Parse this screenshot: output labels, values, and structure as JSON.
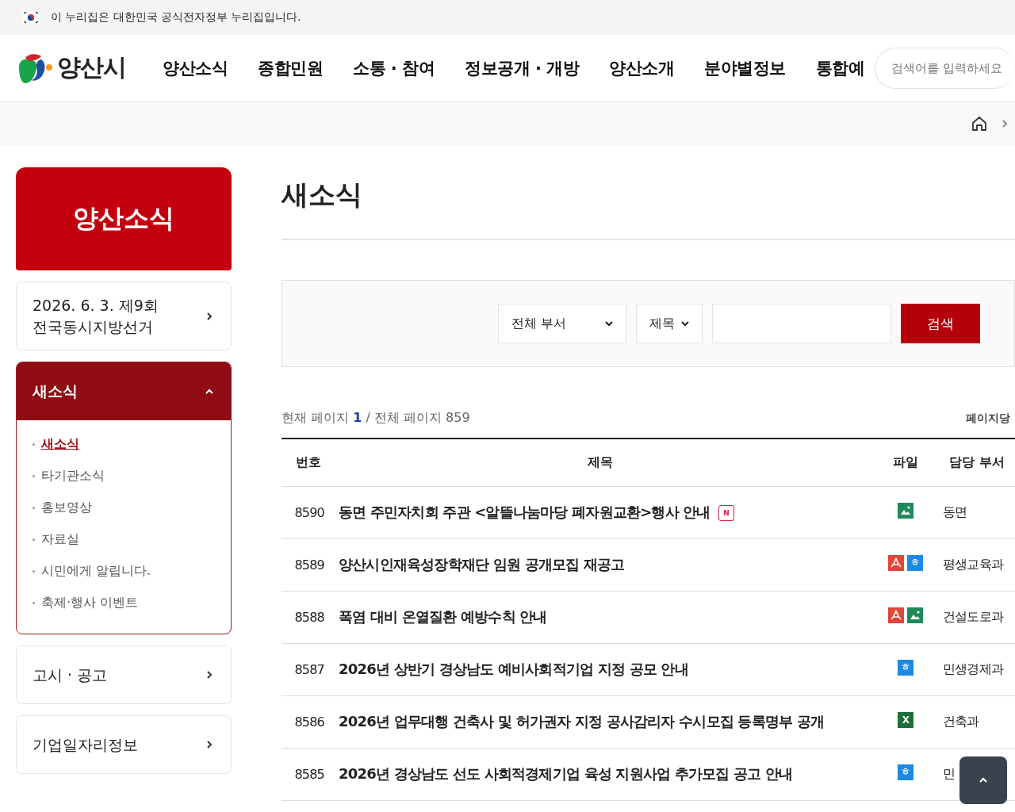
{
  "gov_banner": {
    "text": "이 누리집은 대한민국 공식전자정부 누리집입니다."
  },
  "header": {
    "logo_text": "양산시",
    "nav": [
      "양산소식",
      "종합민원",
      "소통 · 참여",
      "정보공개 · 개방",
      "양산소개",
      "분야별정보",
      "통합예"
    ],
    "search": {
      "placeholder": "검색어를 입력하세요"
    }
  },
  "sidebar": {
    "title": "양산소식",
    "menus": [
      {
        "label": "2026. 6. 3. 제9회\n전국동시지방선거",
        "expanded": false
      },
      {
        "label": "새소식",
        "expanded": true,
        "children": [
          {
            "label": "새소식",
            "selected": true
          },
          {
            "label": "타기관소식",
            "selected": false
          },
          {
            "label": "홍보영상",
            "selected": false
          },
          {
            "label": "자료실",
            "selected": false
          },
          {
            "label": "시민에게 알립니다.",
            "selected": false
          },
          {
            "label": "축제·행사 이벤트",
            "selected": false
          }
        ]
      },
      {
        "label": "고시 · 공고",
        "expanded": false
      },
      {
        "label": "기업일자리정보",
        "expanded": false
      }
    ]
  },
  "page": {
    "title": "새소식",
    "search": {
      "department": "전체 부서",
      "field": "제목",
      "button": "검색"
    },
    "paging": {
      "prefix": "현재 페이지",
      "current": "1",
      "suffix": "/ 전체 페이지 859",
      "per_page": "페이지당"
    },
    "table": {
      "columns": [
        "번호",
        "제목",
        "파일",
        "담당 부서"
      ],
      "rows": [
        {
          "number": "8590",
          "title": "동면 주민자치회 주관 <알뜰나눔마당 폐자원교환>행사 안내",
          "badge": "N",
          "files": [
            {
              "kind": "image"
            }
          ],
          "department": "동면"
        },
        {
          "number": "8589",
          "title": "양산시인재육성장학재단 임원 공개모집 재공고",
          "files": [
            {
              "kind": "pdf"
            },
            {
              "kind": "hwp",
              "label": "ㅎ"
            }
          ],
          "department": "평생교육과"
        },
        {
          "number": "8588",
          "title": "폭염 대비 온열질환 예방수칙 안내",
          "files": [
            {
              "kind": "pdf"
            },
            {
              "kind": "image"
            }
          ],
          "department": "건설도로과"
        },
        {
          "number": "8587",
          "title": "2026년 상반기 경상남도 예비사회적기업 지정 공모 안내",
          "files": [
            {
              "kind": "hwp",
              "label": "ㅎ"
            }
          ],
          "department": "민생경제과"
        },
        {
          "number": "8586",
          "title": "2026년 업무대행 건축사 및 허가권자 지정 공사감리자 수시모집 등록명부 공개",
          "files": [
            {
              "kind": "excel",
              "label": "X"
            }
          ],
          "department": "건축과"
        },
        {
          "number": "8585",
          "title": "2026년 경상남도 선도 사회적경제기업 육성 지원사업 추가모집 공고 안내",
          "files": [
            {
              "kind": "hwp",
              "label": "ㅎ"
            }
          ],
          "department": "민"
        }
      ]
    }
  }
}
